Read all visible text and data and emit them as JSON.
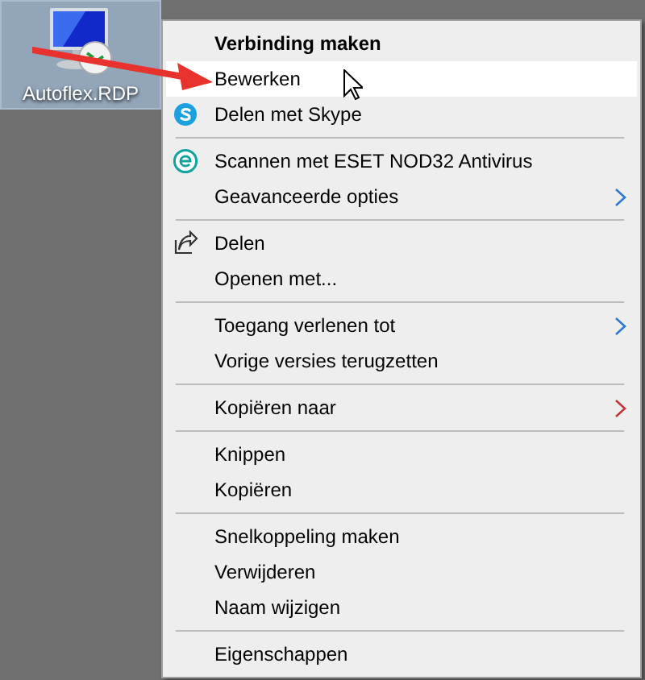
{
  "desktop_icon": {
    "label": "Autoflex.RDP",
    "selected": true
  },
  "context_menu": {
    "items": [
      {
        "kind": "item",
        "label": "Verbinding maken",
        "bold": true,
        "hovered": false
      },
      {
        "kind": "item",
        "label": "Bewerken",
        "bold": false,
        "hovered": true
      },
      {
        "kind": "skype",
        "label": "Delen met Skype",
        "bold": false,
        "hovered": false
      },
      {
        "kind": "separator"
      },
      {
        "kind": "eset",
        "label": "Scannen met ESET NOD32 Antivirus",
        "bold": false,
        "hovered": false
      },
      {
        "kind": "item",
        "label": "Geavanceerde opties",
        "bold": false,
        "hovered": false,
        "submenu": true,
        "color": "#2b7bd6"
      },
      {
        "kind": "separator"
      },
      {
        "kind": "share",
        "label": "Delen",
        "bold": false,
        "hovered": false
      },
      {
        "kind": "item",
        "label": "Openen met...",
        "bold": false,
        "hovered": false
      },
      {
        "kind": "separator"
      },
      {
        "kind": "item",
        "label": "Toegang verlenen tot",
        "bold": false,
        "hovered": false,
        "submenu": true,
        "color": "#2b7bd6"
      },
      {
        "kind": "item",
        "label": "Vorige versies terugzetten",
        "bold": false,
        "hovered": false
      },
      {
        "kind": "separator"
      },
      {
        "kind": "item",
        "label": "Kopiëren naar",
        "bold": false,
        "hovered": false,
        "submenu": true,
        "color": "#c8343c"
      },
      {
        "kind": "separator"
      },
      {
        "kind": "item",
        "label": "Knippen",
        "bold": false,
        "hovered": false
      },
      {
        "kind": "item",
        "label": "Kopiëren",
        "bold": false,
        "hovered": false
      },
      {
        "kind": "separator"
      },
      {
        "kind": "item",
        "label": "Snelkoppeling maken",
        "bold": false,
        "hovered": false
      },
      {
        "kind": "item",
        "label": "Verwijderen",
        "bold": false,
        "hovered": false
      },
      {
        "kind": "item",
        "label": "Naam wijzigen",
        "bold": false,
        "hovered": false
      },
      {
        "kind": "separator"
      },
      {
        "kind": "item",
        "label": "Eigenschappen",
        "bold": false,
        "hovered": false
      }
    ]
  }
}
